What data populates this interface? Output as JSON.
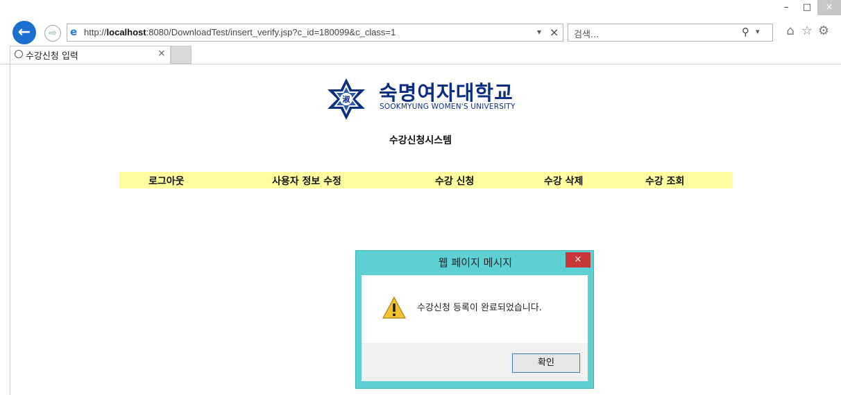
{
  "window": {
    "controls": {
      "minimize": "–",
      "maximize": "□",
      "close": "×"
    }
  },
  "toolbar": {
    "back_glyph": "←",
    "forward_glyph": "⇨",
    "address": {
      "url_prefix": "http://",
      "url_host": "localhost",
      "url_rest": ":8080/DownloadTest/insert_verify.jsp?c_id=180099&c_class=1",
      "dropdown_glyph": "▾",
      "stop_glyph": "×"
    },
    "search": {
      "placeholder": "검색...",
      "search_glyph": "⚲",
      "dropdown_glyph": "▾"
    },
    "icons": {
      "home": "⌂",
      "favorites": "☆",
      "settings": "⚙"
    }
  },
  "tabs": [
    {
      "title": "수강신청 입력",
      "close_glyph": "×"
    }
  ],
  "page": {
    "logo": {
      "korean": "숙명여자대학교",
      "english": "SOOKMYUNG WOMEN'S UNIVERSITY"
    },
    "system_title": "수강신청시스템",
    "menu": [
      "로그아웃",
      "사용자 정보 수정",
      "수강 신청",
      "수강 삭제",
      "수강 조회"
    ]
  },
  "dialog": {
    "title": "웹 페이지 메시지",
    "close_glyph": "×",
    "message": "수강신청 등록이 완료되었습니다.",
    "ok_label": "확인"
  },
  "colors": {
    "menu_bar": "#fefe9e",
    "dialog_frame": "#5cd0d4",
    "dialog_close": "#c8373a",
    "logo_blue": "#0b2f83",
    "back_button": "#1b6fcf"
  }
}
